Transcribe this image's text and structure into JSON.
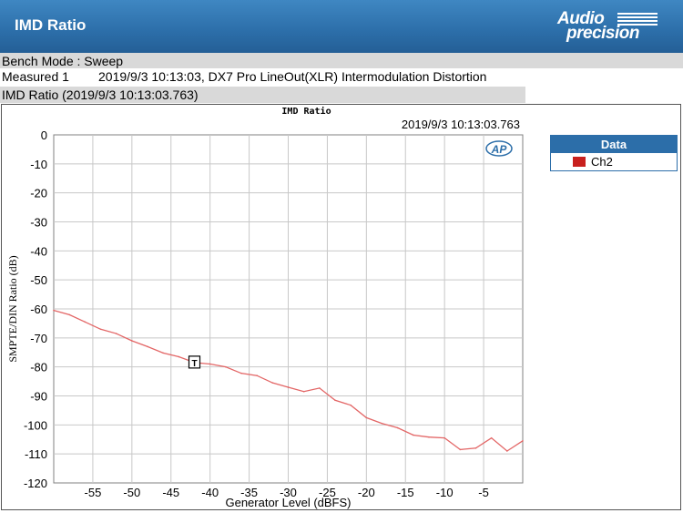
{
  "header": {
    "title": "IMD Ratio"
  },
  "logo": {
    "line1": "Audio",
    "line2": "precision"
  },
  "bench_mode": "Bench Mode : Sweep",
  "measured": {
    "label": "Measured 1",
    "text": "2019/9/3 10:13:03, DX7 Pro LineOut(XLR) Intermodulation Distortion"
  },
  "graph_caption": "IMD Ratio (2019/9/3 10:13:03.763)",
  "colors": {
    "header": "#2c6ea9",
    "series": "#e36666",
    "legend_swatch": "#c8201e",
    "grid": "#c8c8c8"
  },
  "legend": {
    "title": "Data",
    "items": [
      "Ch2"
    ]
  },
  "chart_data": {
    "type": "line",
    "title": "IMD Ratio",
    "timestamp": "2019/9/3 10:13:03.763",
    "xlabel": "Generator Level (dBFS)",
    "ylabel": "SMPTE/DIN Ratio (dB)",
    "xlim": [
      -60,
      0
    ],
    "ylim": [
      -120,
      0
    ],
    "xticks": [
      -55,
      -50,
      -45,
      -40,
      -35,
      -30,
      -25,
      -20,
      -15,
      -10,
      -5
    ],
    "yticks": [
      0,
      -10,
      -20,
      -30,
      -40,
      -50,
      -60,
      -70,
      -80,
      -90,
      -100,
      -110,
      -120
    ],
    "grid": true,
    "legend_position": "right",
    "marker_label": "T",
    "marker_x": -42,
    "series": [
      {
        "name": "Ch2",
        "x": [
          -60,
          -58,
          -56,
          -54,
          -52,
          -50,
          -48,
          -46,
          -44,
          -42,
          -40,
          -38,
          -36,
          -34,
          -32,
          -30,
          -28,
          -26,
          -24,
          -22,
          -20,
          -18,
          -16,
          -14,
          -12,
          -10,
          -8,
          -6,
          -4,
          -2,
          0
        ],
        "y": [
          -60.5,
          -62,
          -64.5,
          -67,
          -68.5,
          -71,
          -73,
          -75.2,
          -76.5,
          -78.5,
          -79,
          -80,
          -82.2,
          -83,
          -85.5,
          -87,
          -88.5,
          -87.3,
          -91.5,
          -93.2,
          -97.5,
          -99.5,
          -101,
          -103.5,
          -104.2,
          -104.5,
          -108.5,
          -108,
          -104.5,
          -109,
          -105.5
        ]
      }
    ]
  }
}
